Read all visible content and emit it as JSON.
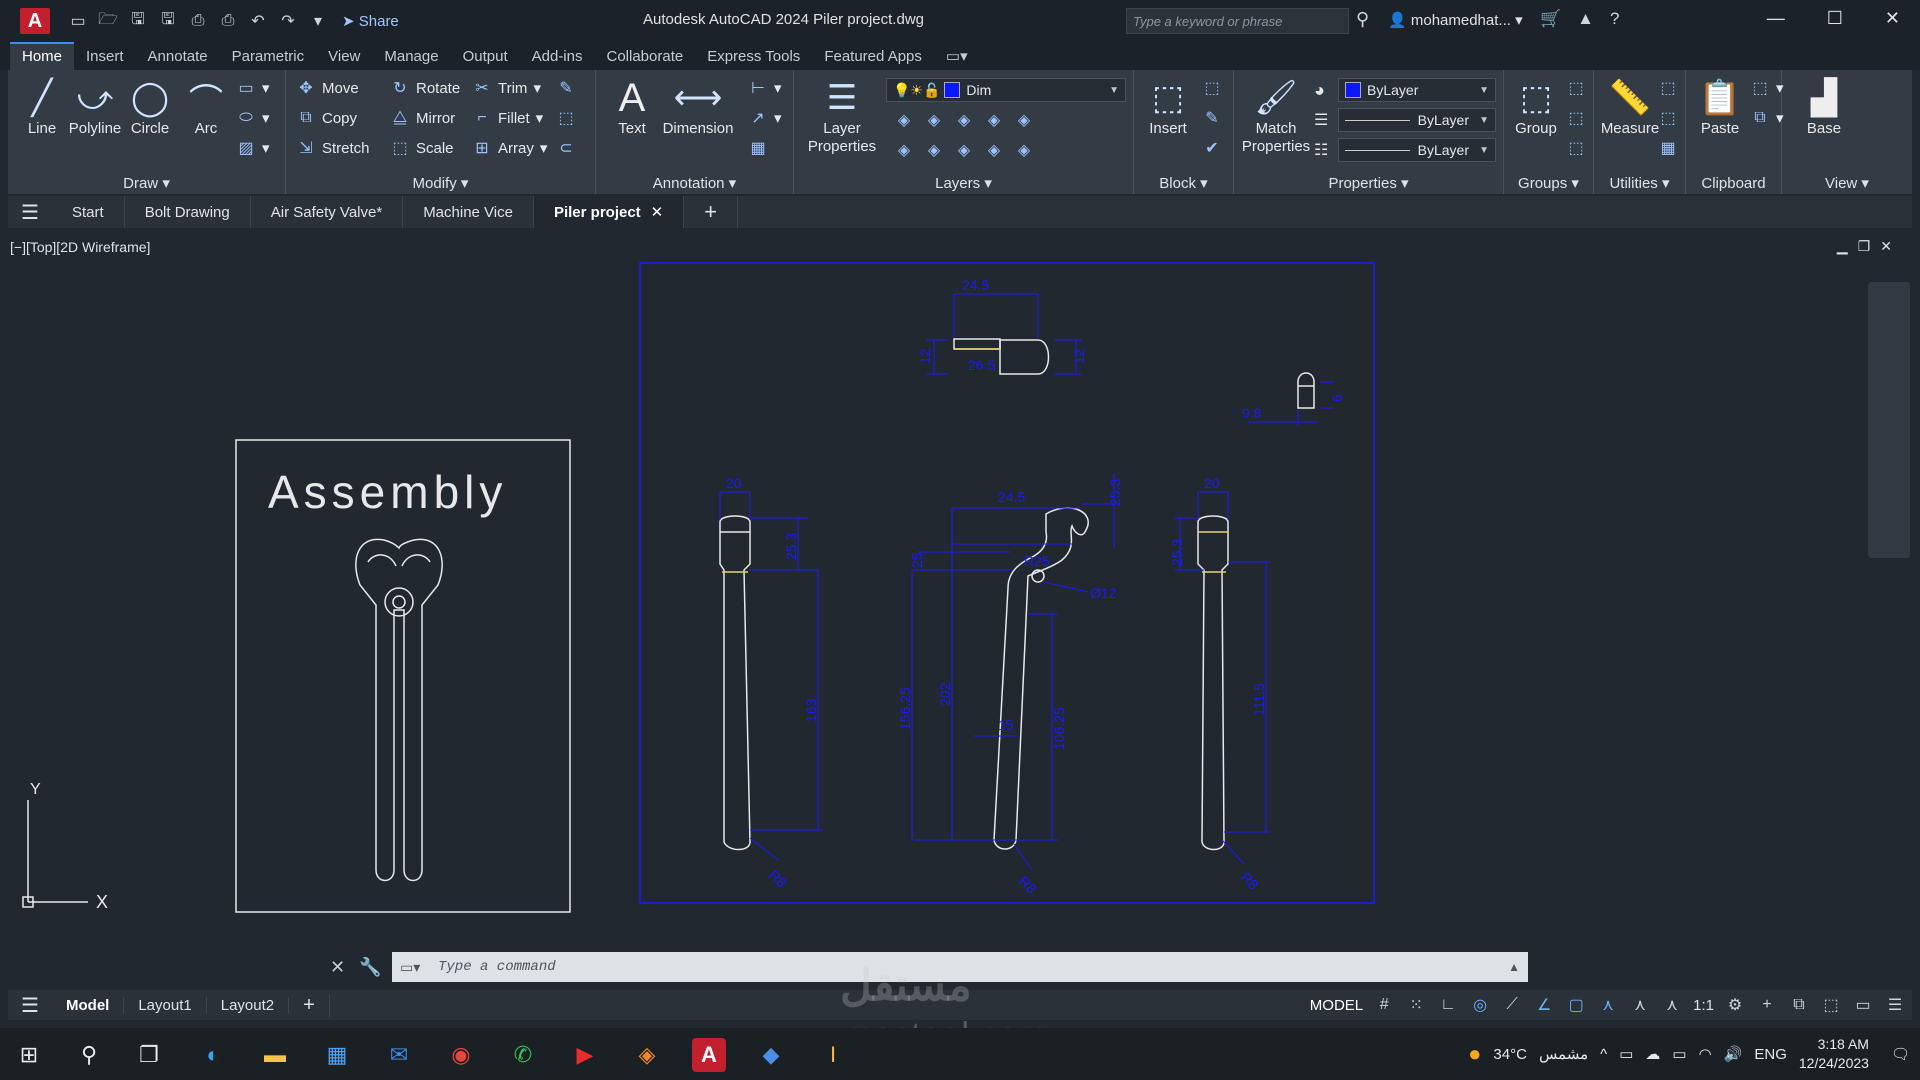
{
  "titlebar": {
    "app_logo": "A",
    "share_label": "Share",
    "title": "Autodesk AutoCAD 2024   Piler project.dwg",
    "search_placeholder": "Type a keyword or phrase",
    "user": "mohamedhat...",
    "window_controls": [
      "minimize-icon",
      "maximize-icon",
      "close-icon"
    ]
  },
  "ribbon_tabs": [
    "Home",
    "Insert",
    "Annotate",
    "Parametric",
    "View",
    "Manage",
    "Output",
    "Add-ins",
    "Collaborate",
    "Express Tools",
    "Featured Apps"
  ],
  "ribbon": {
    "draw": {
      "title": "Draw",
      "tools": [
        "Line",
        "Polyline",
        "Circle",
        "Arc"
      ]
    },
    "modify": {
      "title": "Modify",
      "tools": [
        "Move",
        "Rotate",
        "Trim",
        "Copy",
        "Mirror",
        "Fillet",
        "Stretch",
        "Scale",
        "Array"
      ]
    },
    "annotation": {
      "title": "Annotation",
      "tools": [
        "Text",
        "Dimension"
      ]
    },
    "layers": {
      "title": "Layers",
      "tool": "Layer Properties",
      "current_layer": "Dim"
    },
    "block": {
      "title": "Block",
      "tool": "Insert"
    },
    "properties": {
      "title": "Properties",
      "tool": "Match Properties",
      "color": "ByLayer",
      "linetype": "ByLayer",
      "lineweight": "ByLayer"
    },
    "groups": {
      "title": "Groups",
      "tool": "Group"
    },
    "utilities": {
      "title": "Utilities",
      "tool": "Measure"
    },
    "clipboard": {
      "title": "Clipboard",
      "tool": "Paste"
    },
    "view": {
      "title": "View",
      "tool": "Base"
    }
  },
  "file_tabs": [
    "Start",
    "Bolt Drawing",
    "Air Safety Valve*",
    "Machine Vice",
    "Piler project"
  ],
  "viewport": {
    "label": "[−][Top][2D Wireframe]",
    "assembly_title": "Assembly",
    "ucs": {
      "y": "Y",
      "x": "X"
    },
    "dims": {
      "top_width": "24.5",
      "top_left": "12",
      "top_mid": "26.5",
      "top_right": "12",
      "pin_left": "9.8",
      "pin_right": "6",
      "left_top": "20",
      "left_h1": "25.3",
      "left_h2": "163",
      "left_r": "R8",
      "mid_top": "24.5",
      "mid_r": "R25",
      "mid_topright": "25.3",
      "mid_left": "25",
      "mid_h1": "156.25",
      "mid_h2": "202",
      "mid_h3": "106.25",
      "mid_w": "15",
      "mid_circle": "Ø12",
      "mid_rb": "R8",
      "right_top": "20",
      "right_h1": "25.3",
      "right_h2": "111.5",
      "right_r": "R8"
    }
  },
  "command": {
    "placeholder": "Type a command"
  },
  "layout_tabs": [
    "Model",
    "Layout1",
    "Layout2"
  ],
  "status": {
    "mode": "MODEL",
    "scale": "1:1"
  },
  "watermark": {
    "arabic": "مستقل",
    "latin": "mostaql.com"
  },
  "taskbar": {
    "weather": "34°C",
    "weather_text": "مشمس",
    "lang": "ENG",
    "time": "3:18 AM",
    "date": "12/24/2023"
  },
  "colors": {
    "dim": "#1a1aff",
    "geometry": "#e8e8e8",
    "accent": "#3d8ee8"
  }
}
